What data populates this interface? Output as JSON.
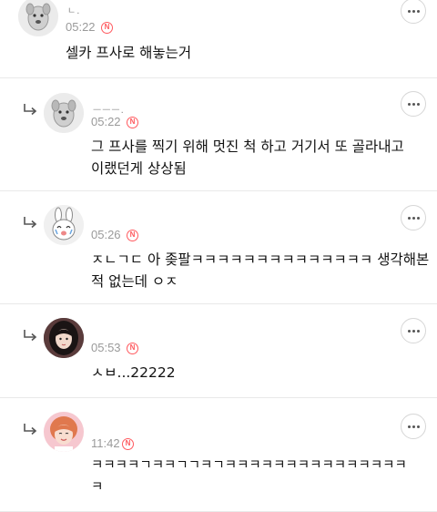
{
  "comments": [
    {
      "nickname": "ㄴ.",
      "time": "05:22",
      "badge": "N",
      "is_reply": false,
      "avatar_icon": "dog-avatar-icon",
      "lines": [
        "셀카 프사로 해놓는거"
      ]
    },
    {
      "nickname": "ᅳᅳᅳ.",
      "time": "05:22",
      "badge": "N",
      "is_reply": true,
      "avatar_icon": "dog-avatar-icon",
      "lines": [
        "그 프사를 찍기 위해 멋진 척 하고 거기서 또 골라내고",
        "이랬던게 상상됨"
      ]
    },
    {
      "nickname": "",
      "time": "05:26",
      "badge": "N",
      "is_reply": true,
      "avatar_icon": "bunny-avatar-icon",
      "lines": [
        "ㅈㄴㄱㄷ 아 좆팔ㅋㅋㅋㅋㅋㅋㅋㅋㅋㅋㅋㅋㅋㅋ 생각해본",
        "적 없는데 ㅇㅈ"
      ]
    },
    {
      "nickname": "",
      "time": "05:53",
      "badge": "N",
      "is_reply": true,
      "avatar_icon": "girl-photo-avatar",
      "lines": [
        "ㅅㅂ...22222"
      ]
    },
    {
      "nickname": "",
      "time": "11:42",
      "badge": "N",
      "is_reply": true,
      "avatar_icon": "boy-photo-avatar",
      "lines": [
        "ㅋㅋㅋㅋㄱㅋㅋㄱㄱㅋㄱㅋㅋㅋㅋㅋㅋㅋㅋㅋㅋㅋㅋㅋㅋㅋ",
        "ㅋ"
      ]
    }
  ],
  "colors": {
    "badge": "#ff5a5f",
    "time": "#9a9a9a",
    "divider": "#e9e9e9"
  }
}
